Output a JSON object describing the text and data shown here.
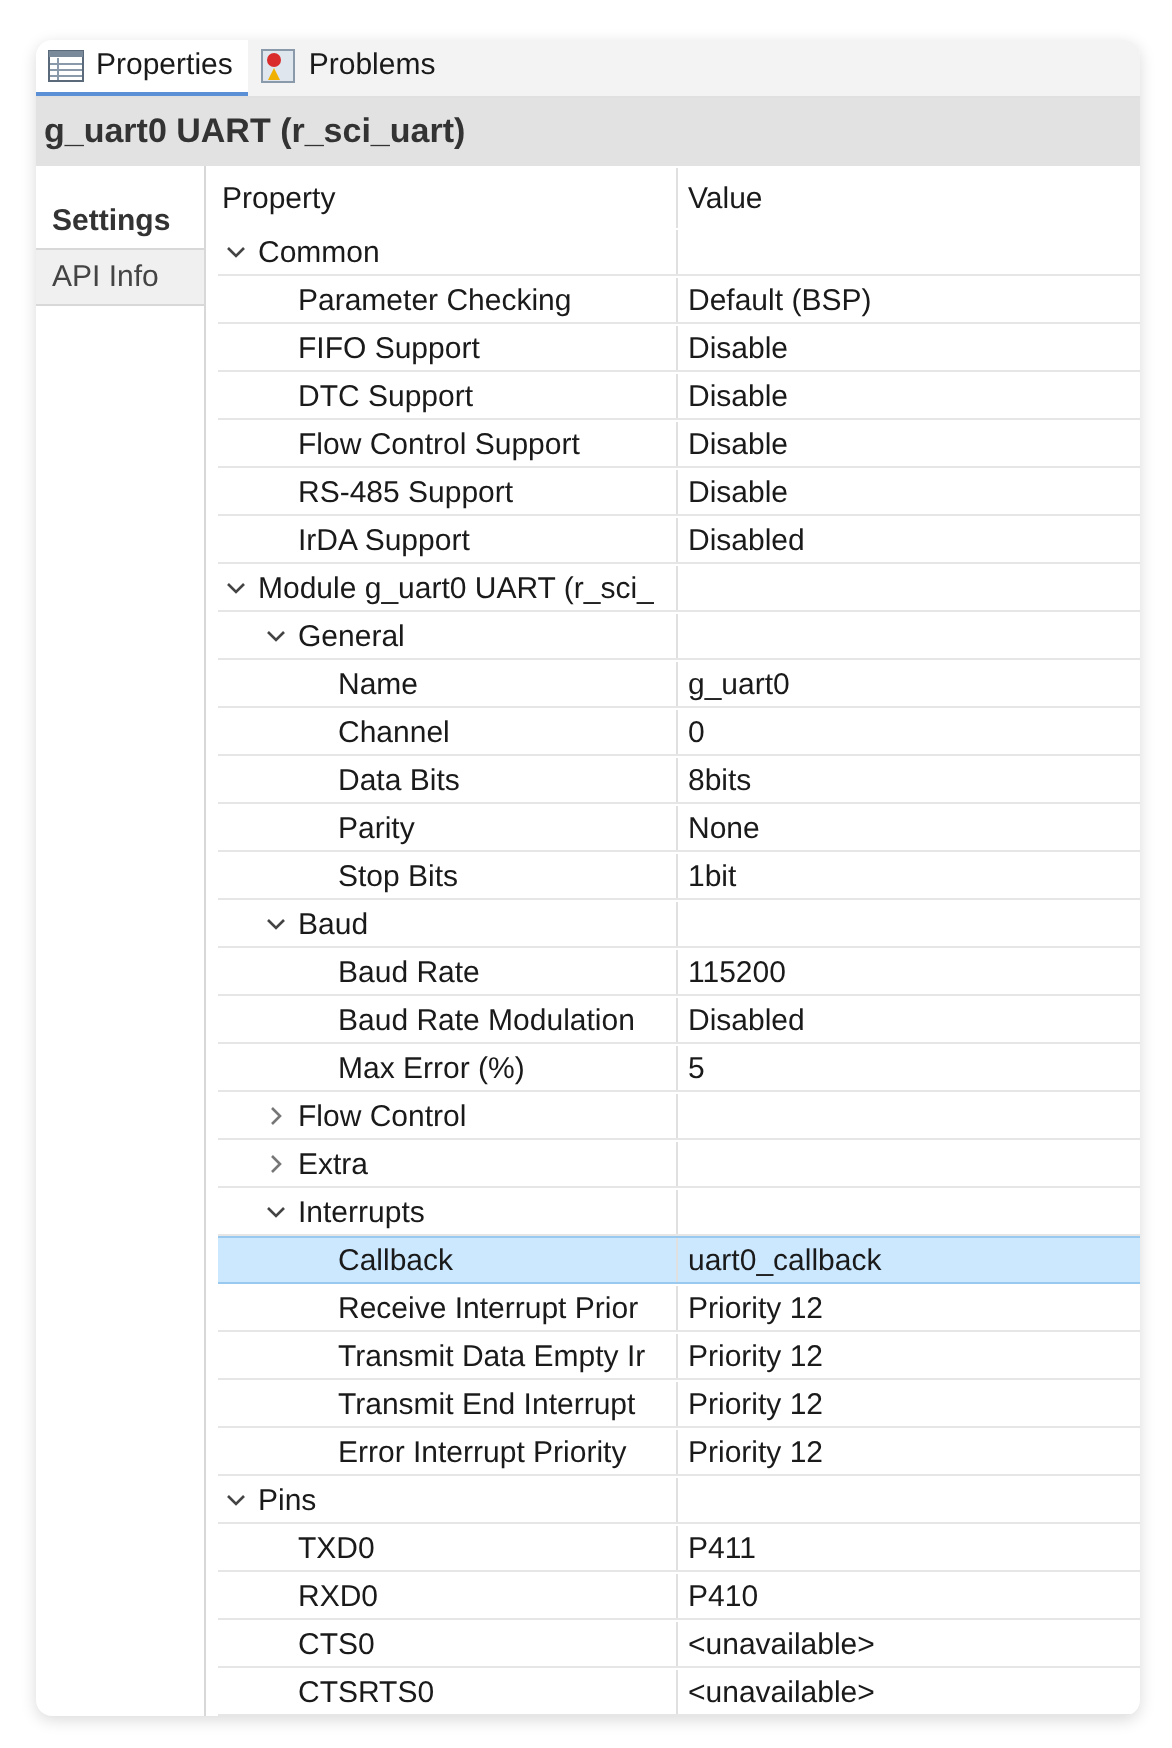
{
  "tabs": [
    {
      "label": "Properties",
      "kind": "table",
      "selected": true
    },
    {
      "label": "Problems",
      "kind": "problems",
      "selected": false
    }
  ],
  "title": "g_uart0 UART (r_sci_uart)",
  "sidebar": {
    "items": [
      {
        "label": "Settings",
        "selected": true
      },
      {
        "label": "API Info",
        "selected": false
      }
    ]
  },
  "table": {
    "columns": [
      "Property",
      "Value"
    ],
    "rows": [
      {
        "property": "Common",
        "expanded": true,
        "selected": false,
        "children": [
          {
            "property": "Parameter Checking",
            "value": "Default (BSP)",
            "selected": false
          },
          {
            "property": "FIFO Support",
            "value": "Disable",
            "selected": false
          },
          {
            "property": "DTC Support",
            "value": "Disable",
            "selected": false
          },
          {
            "property": "Flow Control Support",
            "value": "Disable",
            "selected": false
          },
          {
            "property": "RS-485 Support",
            "value": "Disable",
            "selected": false
          },
          {
            "property": "IrDA Support",
            "value": "Disabled",
            "selected": false
          }
        ]
      },
      {
        "property": "Module g_uart0 UART (r_sci_",
        "expanded": true,
        "selected": false,
        "children": [
          {
            "property": "General",
            "expanded": true,
            "selected": false,
            "children": [
              {
                "property": "Name",
                "value": "g_uart0",
                "selected": false
              },
              {
                "property": "Channel",
                "value": "0",
                "selected": false
              },
              {
                "property": "Data Bits",
                "value": "8bits",
                "selected": false
              },
              {
                "property": "Parity",
                "value": "None",
                "selected": false
              },
              {
                "property": "Stop Bits",
                "value": "1bit",
                "selected": false
              }
            ]
          },
          {
            "property": "Baud",
            "expanded": true,
            "selected": false,
            "children": [
              {
                "property": "Baud Rate",
                "value": "115200",
                "selected": false
              },
              {
                "property": "Baud Rate Modulation",
                "value": "Disabled",
                "selected": false
              },
              {
                "property": "Max Error (%)",
                "value": "5",
                "selected": false
              }
            ]
          },
          {
            "property": "Flow Control",
            "expanded": false,
            "selected": false
          },
          {
            "property": "Extra",
            "expanded": false,
            "selected": false
          },
          {
            "property": "Interrupts",
            "expanded": true,
            "selected": false,
            "children": [
              {
                "property": "Callback",
                "value": "uart0_callback",
                "selected": true
              },
              {
                "property": "Receive Interrupt Prior",
                "value": "Priority 12",
                "selected": false
              },
              {
                "property": "Transmit Data Empty Ir",
                "value": "Priority 12",
                "selected": false
              },
              {
                "property": "Transmit End Interrupt",
                "value": "Priority 12",
                "selected": false
              },
              {
                "property": "Error Interrupt Priority",
                "value": "Priority 12",
                "selected": false
              }
            ]
          }
        ]
      },
      {
        "property": "Pins",
        "expanded": true,
        "selected": false,
        "children": [
          {
            "property": "TXD0",
            "value": "P411",
            "selected": false
          },
          {
            "property": "RXD0",
            "value": "P410",
            "selected": false
          },
          {
            "property": "CTS0",
            "value": "<unavailable>",
            "selected": false
          },
          {
            "property": "CTSRTS0",
            "value": "<unavailable>",
            "selected": false
          }
        ]
      }
    ]
  }
}
